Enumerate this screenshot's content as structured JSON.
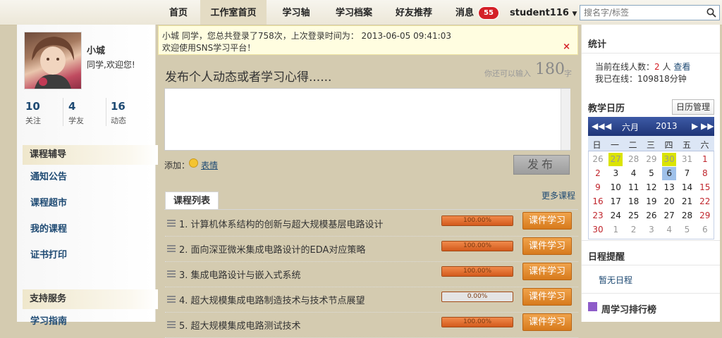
{
  "nav": {
    "items": [
      "首页",
      "工作室首页",
      "学习轴",
      "学习档案",
      "好友推荐",
      "消息"
    ],
    "message_count": "55",
    "user": "student116",
    "search_placeholder": "搜名字/标签"
  },
  "profile": {
    "name": "小城",
    "welcome": "同学,欢迎您!",
    "stats": [
      {
        "num": "10",
        "label": "关注"
      },
      {
        "num": "4",
        "label": "学友"
      },
      {
        "num": "16",
        "label": "动态"
      }
    ]
  },
  "sidebar": {
    "course_section": "课程辅导",
    "course_links": [
      "通知公告",
      "课程超市",
      "我的课程",
      "证书打印"
    ],
    "support_section": "支持服务",
    "support_links": [
      "学习指南"
    ]
  },
  "notice": {
    "line1": "小城 同学，您总共登录了758次，上次登录时间为： 2013-06-05 09:41:03",
    "line2": "欢迎使用SNS学习平台！",
    "close": "×"
  },
  "post": {
    "title": "发布个人动态或者学习心得......",
    "hint_prefix": "你还可以输入",
    "remaining": "180",
    "hint_suffix": "字",
    "add_label": "添加：",
    "emoji_link": "表情",
    "publish": "发布"
  },
  "courses": {
    "tab": "课程列表",
    "more": "更多课程",
    "button": "课件学习",
    "rows": [
      {
        "title": "1. 计算机体系结构的创新与超大规模基层电路设计",
        "progress": "100.00%",
        "pct": 100
      },
      {
        "title": "2. 面向深亚微米集成电路设计的EDA对应策略",
        "progress": "100.00%",
        "pct": 100
      },
      {
        "title": "3. 集成电路设计与嵌入式系统",
        "progress": "100.00%",
        "pct": 100
      },
      {
        "title": "4. 超大规模集成电路制造技术与技术节点展望",
        "progress": "0.00%",
        "pct": 0
      },
      {
        "title": "5. 超大规模集成电路测试技术",
        "progress": "100.00%",
        "pct": 100
      }
    ]
  },
  "stats_panel": {
    "title": "统计",
    "online_prefix": "当前在线人数：",
    "online_count": "2",
    "online_unit": "人",
    "view_link": "查看",
    "my_online": "我已在线：109818分钟"
  },
  "calendar": {
    "title": "教学日历",
    "manage": "日历管理",
    "prev_year": "◀◀",
    "prev_month": "◀",
    "month": "六月",
    "year": "2013",
    "next_month": "▶",
    "next_year": "▶▶",
    "weekdays": [
      "日",
      "一",
      "二",
      "三",
      "四",
      "五",
      "六"
    ],
    "weeks": [
      [
        "26",
        "27",
        "28",
        "29",
        "30",
        "31",
        "1"
      ],
      [
        "2",
        "3",
        "4",
        "5",
        "6",
        "7",
        "8"
      ],
      [
        "9",
        "10",
        "11",
        "12",
        "13",
        "14",
        "15"
      ],
      [
        "16",
        "17",
        "18",
        "19",
        "20",
        "21",
        "22"
      ],
      [
        "23",
        "24",
        "25",
        "26",
        "27",
        "28",
        "29"
      ],
      [
        "30",
        "1",
        "2",
        "3",
        "4",
        "5",
        "6"
      ]
    ],
    "highlight_yellow": [
      [
        0,
        1
      ],
      [
        0,
        4
      ]
    ],
    "highlight_blue": [
      [
        1,
        4
      ]
    ]
  },
  "schedule": {
    "title": "日程提醒",
    "empty": "暂无日程"
  },
  "ranking": {
    "title": "周学习排行榜"
  }
}
